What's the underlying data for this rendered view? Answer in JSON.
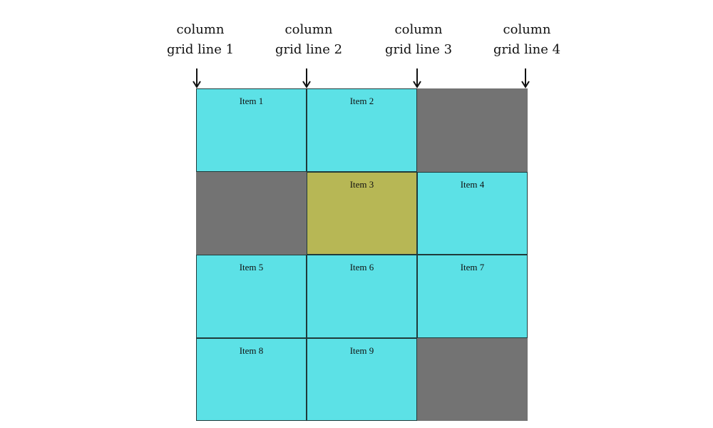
{
  "labels": [
    {
      "line1": "column",
      "line2": "grid line 1"
    },
    {
      "line1": "column",
      "line2": "grid line 2"
    },
    {
      "line1": "column",
      "line2": "grid line 3"
    },
    {
      "line1": "column",
      "line2": "grid line 4"
    }
  ],
  "colors": {
    "item": "#5ce1e6",
    "highlight": "#b7b755",
    "empty": "#737373"
  },
  "items": [
    {
      "label": "Item 1",
      "col": 1,
      "row": 1
    },
    {
      "label": "Item 2",
      "col": 2,
      "row": 1
    },
    {
      "label": "Item 3",
      "col": 2,
      "row": 2,
      "highlight": true
    },
    {
      "label": "Item 4",
      "col": 3,
      "row": 2
    },
    {
      "label": "Item 5",
      "col": 1,
      "row": 3
    },
    {
      "label": "Item 6",
      "col": 2,
      "row": 3
    },
    {
      "label": "Item 7",
      "col": 3,
      "row": 3
    },
    {
      "label": "Item 8",
      "col": 1,
      "row": 4
    },
    {
      "label": "Item 9",
      "col": 2,
      "row": 4
    }
  ]
}
